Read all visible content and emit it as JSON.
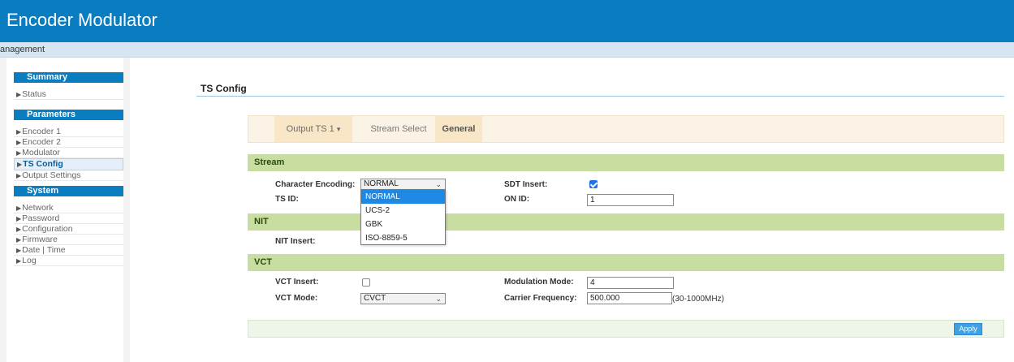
{
  "app": {
    "title": "Encoder Modulator"
  },
  "menubar": {
    "item": "anagement"
  },
  "sidebar": {
    "sections": [
      {
        "title": "Summary",
        "items": [
          "Status"
        ]
      },
      {
        "title": "Parameters",
        "items": [
          "Encoder 1",
          "Encoder 2",
          "Modulator",
          "TS Config",
          "Output Settings"
        ]
      },
      {
        "title": "System",
        "items": [
          "Network",
          "Password",
          "Configuration",
          "Firmware",
          "Date | Time",
          "Log"
        ]
      }
    ],
    "active_item": "TS Config"
  },
  "page": {
    "title": "TS Config"
  },
  "tabs": {
    "output": "Output TS 1",
    "output_caret": "▾",
    "stream_select": "Stream Select",
    "general": "General"
  },
  "stream": {
    "header": "Stream",
    "char_encoding_label": "Character Encoding:",
    "char_encoding_value": "NORMAL",
    "char_encoding_options": [
      "NORMAL",
      "UCS-2",
      "GBK",
      "ISO-8859-5"
    ],
    "sdt_insert_label": "SDT Insert:",
    "sdt_insert_checked": true,
    "ts_id_label": "TS ID:",
    "on_id_label": "ON ID:",
    "on_id_value": "1"
  },
  "nit": {
    "header": "NIT",
    "nit_insert_label": "NIT Insert:"
  },
  "vct": {
    "header": "VCT",
    "vct_insert_label": "VCT Insert:",
    "vct_insert_checked": false,
    "modulation_mode_label": "Modulation Mode:",
    "modulation_mode_value": "4",
    "vct_mode_label": "VCT Mode:",
    "vct_mode_value": "CVCT",
    "carrier_freq_label": "Carrier Frequency:",
    "carrier_freq_value": "500.000",
    "carrier_freq_unit": "(30-1000MHz)"
  },
  "apply_label": "Apply",
  "icons": {
    "triangle": "▶",
    "chevron": "⌄"
  }
}
